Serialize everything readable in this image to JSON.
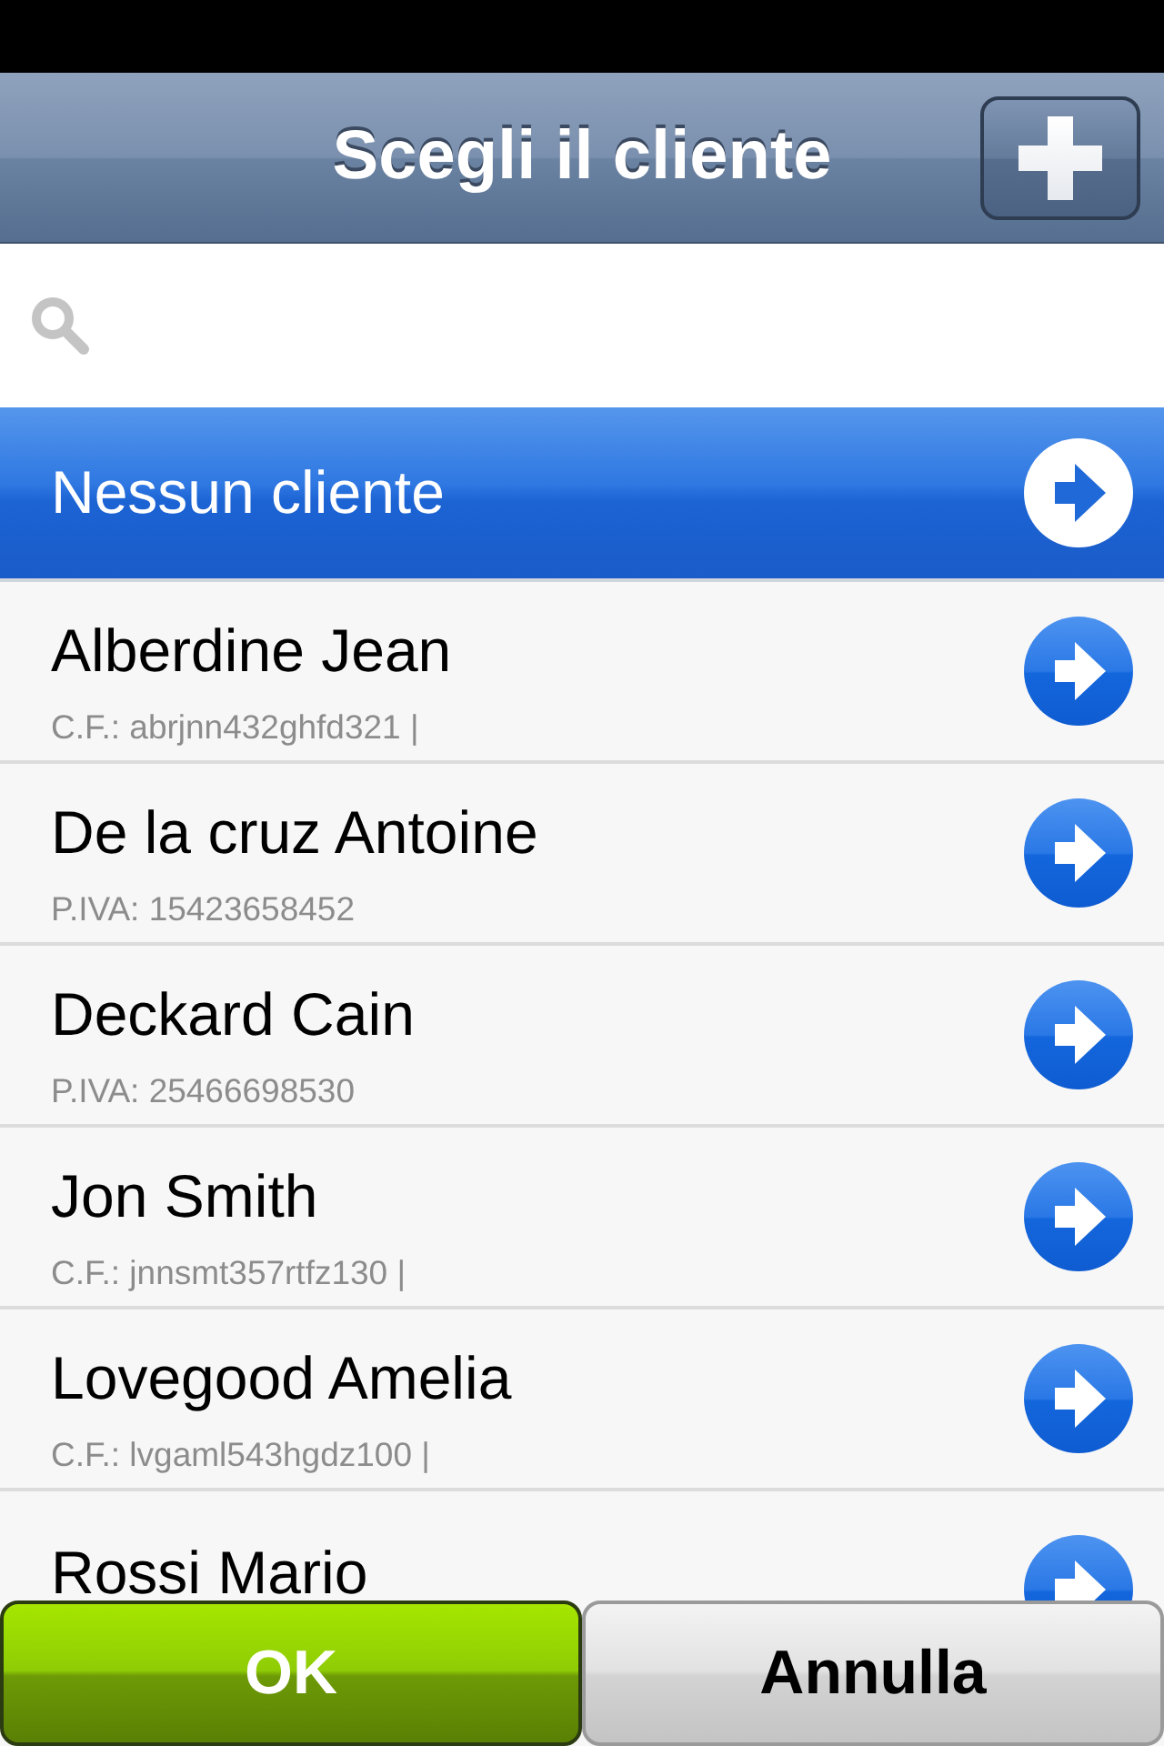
{
  "nav_bar": {
    "title": "Scegli il cliente"
  },
  "clients": [
    {
      "name": "Nessun cliente",
      "selected": true
    },
    {
      "name": "Alberdine Jean",
      "detail": "C.F.: abrjnn432ghfd321 |",
      "selected": false
    },
    {
      "name": "De la cruz Antoine",
      "detail": "P.IVA: 15423658452",
      "selected": false
    },
    {
      "name": "Deckard Cain",
      "detail": "P.IVA: 25466698530",
      "selected": false
    },
    {
      "name": "Jon Smith",
      "detail": "C.F.: jnnsmt357rtfz130 |",
      "selected": false
    },
    {
      "name": "Lovegood Amelia",
      "detail": "C.F.: lvgaml543hgdz100 |",
      "selected": false
    },
    {
      "name": "Rossi Mario",
      "selected": false
    }
  ],
  "buttons": [
    {
      "label": "OK",
      "kind": "confirm"
    },
    {
      "label": "Annulla",
      "kind": "cancel"
    }
  ]
}
